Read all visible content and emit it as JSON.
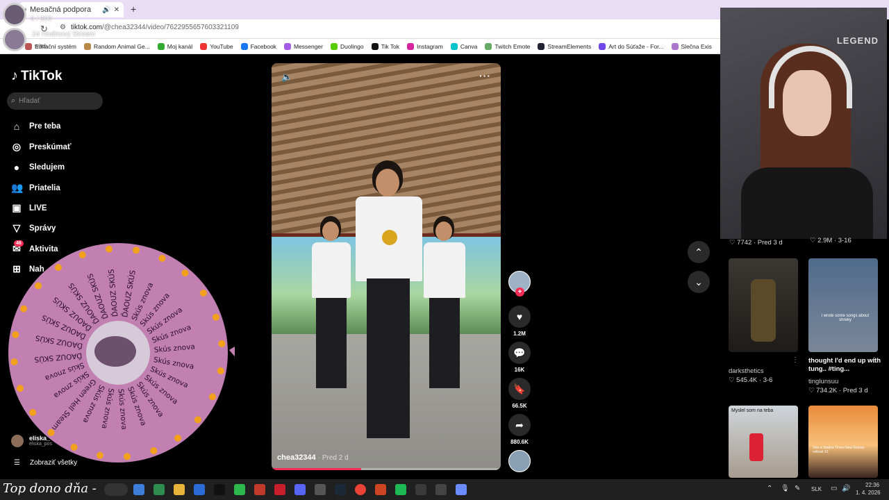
{
  "browser": {
    "tab_title": "Mesačná podpora",
    "url_host": "tiktok.com",
    "url_path": "/@chea32344/video/7622955657603321109",
    "bookmarks": [
      "Editační systém",
      "Random Animal Ge...",
      "Moj kanál",
      "YouTube",
      "Facebook",
      "Messenger",
      "Duolingo",
      "Tik Tok",
      "Instagram",
      "Canva",
      "Twitch Emote",
      "StreamElements",
      "Art do Súťaže - For...",
      "Slečna Exis"
    ],
    "bookmark_colors": [
      "#b55",
      "#b88a4a",
      "#3a3",
      "#e33",
      "#1877f2",
      "#a45ee5",
      "#58cc02",
      "#111",
      "#d6249f",
      "#00c4cc",
      "#6a6",
      "#223",
      "#7048e8",
      "#a7c"
    ],
    "overlay_top": "0 / 300",
    "overlay_stream": "24 Hodinový Stream",
    "overlay_bm": "witch"
  },
  "sidebar": {
    "logo": "TikTok",
    "search_placeholder": "Hľadať",
    "nav": [
      {
        "label": "Pre teba",
        "icon": "home-icon",
        "glyph": "⌂"
      },
      {
        "label": "Preskúmať",
        "icon": "compass-icon",
        "glyph": "◎"
      },
      {
        "label": "Sledujem",
        "icon": "following-avatar-icon",
        "glyph": "●"
      },
      {
        "label": "Priatelia",
        "icon": "friends-icon",
        "glyph": "👥"
      },
      {
        "label": "LIVE",
        "icon": "live-icon",
        "glyph": "▣"
      },
      {
        "label": "Správy",
        "icon": "messages-icon",
        "glyph": "▽"
      },
      {
        "label": "Aktivita",
        "icon": "activity-icon",
        "glyph": "✉"
      },
      {
        "label": "Nah",
        "icon": "upload-icon",
        "glyph": "⊞"
      }
    ],
    "activity_badge": "46",
    "followed_account_name": "eliska_",
    "followed_account_sub": "eliska_pos",
    "see_all": "Zobraziť všetky"
  },
  "wheel": {
    "labels": [
      "Skús znova",
      "Skús znova",
      "Skús znova",
      "Skús znova",
      "Skús znova",
      "Skús znova",
      "Skús znova",
      "Skús znova",
      "Skús znova",
      "Green Hell Steam",
      "Skús znova",
      "Skús znova",
      "ĎAOUZ SKÚS",
      "ĎAOUZ SKÚS",
      "ĎAOUZ SKÚS",
      "ĎAOUZ SKÚS",
      "ĎAOUZ SKÚS",
      "ĎAOUZ SKÚS",
      "ĎAOUZ SKÚS",
      "ĎAOUZ SKÚS",
      "Skús znova",
      "Skús znova",
      "Skús znova",
      "Skús znova"
    ],
    "color": "#c17fb2"
  },
  "video": {
    "author": "chea32344",
    "ago": "· Pred 2 d",
    "progress": 0.39,
    "more": "···"
  },
  "actions": {
    "likes": "1.2M",
    "comments": "16K",
    "saves": "66.5K",
    "shares": "880.6K"
  },
  "webcam": {
    "brand": "LEGEND"
  },
  "grid": {
    "top_stats": [
      "♡ 7742 · Pred 3 d",
      "♡ 2.9M · 3-16"
    ],
    "items": [
      {
        "user": "darksthetics",
        "stat": "♡ 545.4K · 3-6",
        "caption": ""
      },
      {
        "user": "tinglunsuu",
        "stat": "♡ 734.2K · Pred 3 d",
        "caption": "thought I'd end up with tung.. #ting..."
      }
    ],
    "thumb2_overlay": "i wrote some songs about shreky",
    "thumb3_overlay": "Myslel som na teba",
    "thumb4_overlay": "Toto a Stadne Times New Roman velkost 12"
  },
  "taskbar": {
    "overlay_text": "Top dono dňa -",
    "lang": "SLK",
    "time": "22:36",
    "date": "1. 4. 2026"
  }
}
